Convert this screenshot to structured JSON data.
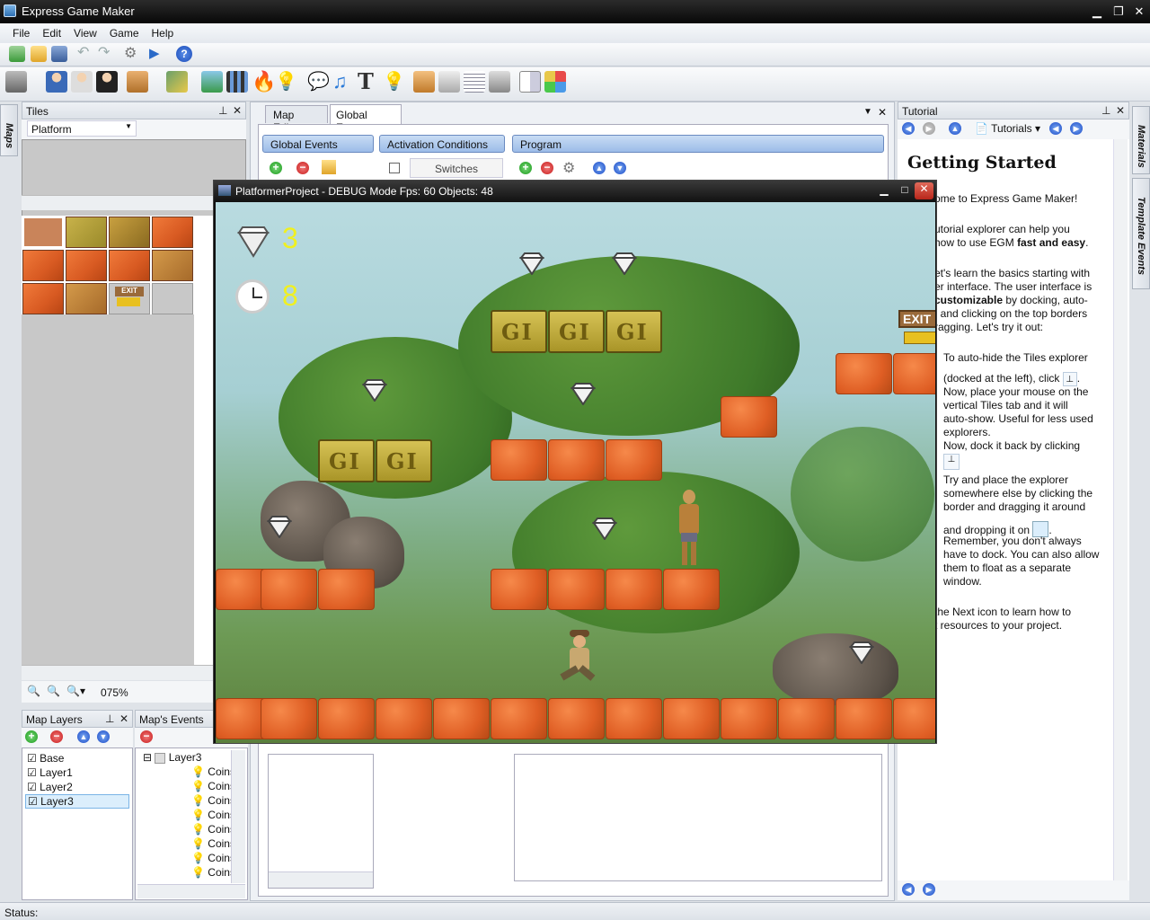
{
  "window": {
    "title": "Express Game Maker"
  },
  "menu": [
    "File",
    "Edit",
    "View",
    "Game",
    "Help"
  ],
  "tiles_panel": {
    "title": "Tiles",
    "tileset": "Platform",
    "zoom": "075%"
  },
  "tile_sign_text": "EXIT",
  "map_layers": {
    "title": "Map Layers",
    "layers": [
      "Base",
      "Layer1",
      "Layer2",
      "Layer3"
    ]
  },
  "map_events": {
    "title": "Map's Events",
    "root": "Layer3",
    "items": [
      "Coins",
      "Coins",
      "Coins",
      "Coins",
      "Coins",
      "Coins",
      "Coins",
      "Coins"
    ]
  },
  "left_vtab": "Maps",
  "editor": {
    "tabs": [
      "Map Editor",
      "Global Events"
    ],
    "sections": {
      "global_events": "Global Events",
      "activation_conditions": "Activation Conditions",
      "program": "Program"
    },
    "switches_label": "Switches"
  },
  "game": {
    "title": "PlatformerProject - DEBUG Mode Fps: 60 Objects: 48",
    "hud_gems": "3",
    "hud_time": "8",
    "exit_sign": "EXIT"
  },
  "tutorial": {
    "title": "Tutorial",
    "nav_label": "Tutorials",
    "heading": "Getting Started",
    "lines": [
      "ome to Express Game Maker!",
      "utorial explorer can help you",
      "how to use EGM",
      "fast and easy",
      "et's learn the basics starting with",
      "er interface. The user interface is",
      "customizable",
      " by docking, auto-",
      ", and clicking on the top borders",
      "ragging. Let's try it out:",
      "To auto-hide the Tiles explorer",
      "(docked at the left), click",
      "Now, place your mouse on the",
      "vertical Tiles tab and it will",
      "auto-show. Useful for less used",
      "explorers.",
      "Now, dock it back by clicking",
      "Try and place the explorer",
      "somewhere else by clicking the",
      "border and dragging it around",
      "and dropping it on",
      "Remember, you don't always",
      "have to dock. You can also allow",
      "them to float as a separate",
      "window.",
      "the Next icon to learn how to",
      "t resources to your project."
    ]
  },
  "right_vtabs": [
    "Materials",
    "Template Events"
  ],
  "status": {
    "label": "Status:"
  }
}
